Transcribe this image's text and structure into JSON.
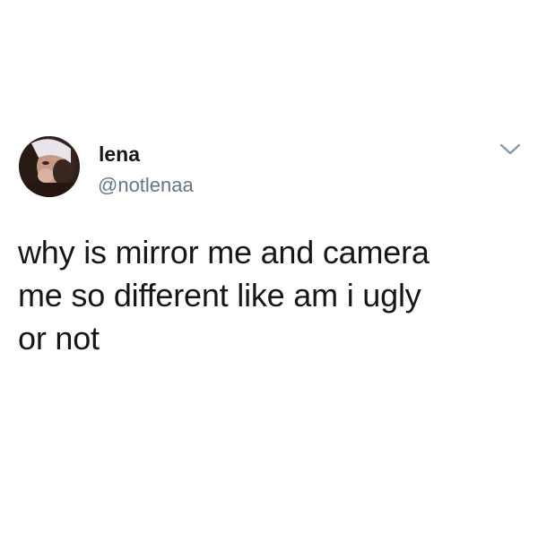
{
  "tweet": {
    "author": {
      "display_name": "lena",
      "handle": "@notlenaa",
      "avatar": "profile-photo"
    },
    "menu_icon": "chevron-down-icon",
    "text_lines": [
      "why is mirror me and camera",
      "me so different like am i ugly",
      "or not"
    ]
  },
  "colors": {
    "text": "#14171a",
    "secondary_text": "#657786",
    "background": "#ffffff",
    "caret": "#8899a6"
  }
}
